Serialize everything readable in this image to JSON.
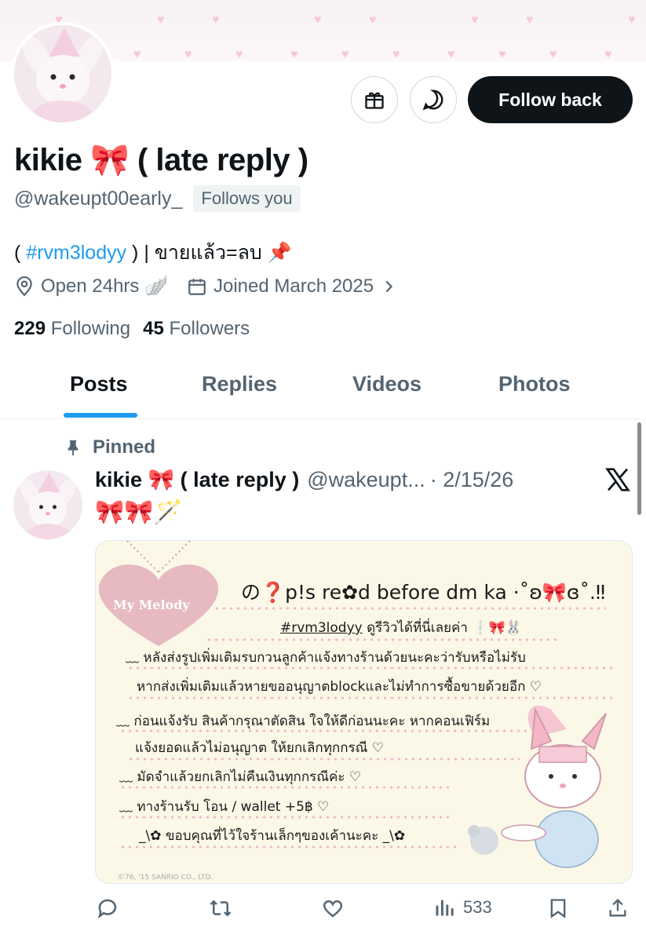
{
  "profile": {
    "name": "kikie 🎀 ( late reply )",
    "handle": "@wakeupt00early_",
    "follows_you": "Follows you",
    "bio_prefix": "( ",
    "bio_tag": "#rvm3lodyy",
    "bio_suffix": " ) | ขายแล้ว=ลบ 📌",
    "location": "Open 24hrs 🪽",
    "joined": "Joined March 2025",
    "following_count": "229",
    "following_label": "Following",
    "followers_count": "45",
    "followers_label": "Followers"
  },
  "actions": {
    "follow_back": "Follow back",
    "gift_icon": "gift-icon",
    "message_icon": "message-icon"
  },
  "tabs": [
    {
      "label": "Posts",
      "active": true
    },
    {
      "label": "Replies",
      "active": false
    },
    {
      "label": "Videos",
      "active": false
    },
    {
      "label": "Photos",
      "active": false
    }
  ],
  "post": {
    "pinned_label": "Pinned",
    "author_name": "kikie 🎀 ( late reply )",
    "author_handle": "@wakeupt...",
    "date": "· 2/15/26",
    "text": "🎀🎀🪄",
    "views": "533",
    "card": {
      "brand": "My Melody",
      "title": "の❓p!s re✿d before dm ka ·˚ʚ🎀ɞ˚.‼",
      "tagline_tag": "#rvm3lodyy",
      "tagline_rest": " ดูรีวิวได้ที่นี่เลยค่า ❕🎀🐰",
      "lines": [
        "﹏ หลังส่งรูปเพิ่มเติมรบกวนลูกค้าแจ้งทางร้านด้วยนะคะว่ารับหรือไม่รับ",
        "หากส่งเพิ่มเติมแล้วหายขออนุญาตblockและไม่ทำการซื้อขายด้วยอีก ♡",
        "﹏ ก่อนแจ้งรับ สินค้ากรุณาตัดสิน ใจให้ดีก่อนนะคะ หากคอนเฟิร์ม",
        "แจ้งยอดแล้วไม่อนุญาต ให้ยกเลิกทุกกรณี ♡",
        "﹏ มัดจำแล้วยกเลิกไม่คืนเงินทุกกรณีค่ะ ♡",
        "﹏ ทางร้านรับ โอน / wallet +5฿ ♡",
        "_\\✿ ขอบคุณที่ไว้ใจร้านเล็กๆของเค้านะคะ _\\✿"
      ],
      "copyright": "©76, '15 SANRIO CO., LTD."
    }
  },
  "colors": {
    "accent": "#1d9bf0",
    "text_primary": "#0f1419",
    "text_secondary": "#536471",
    "card_bg": "#fbf8e8",
    "pink": "#f2b6c8"
  }
}
